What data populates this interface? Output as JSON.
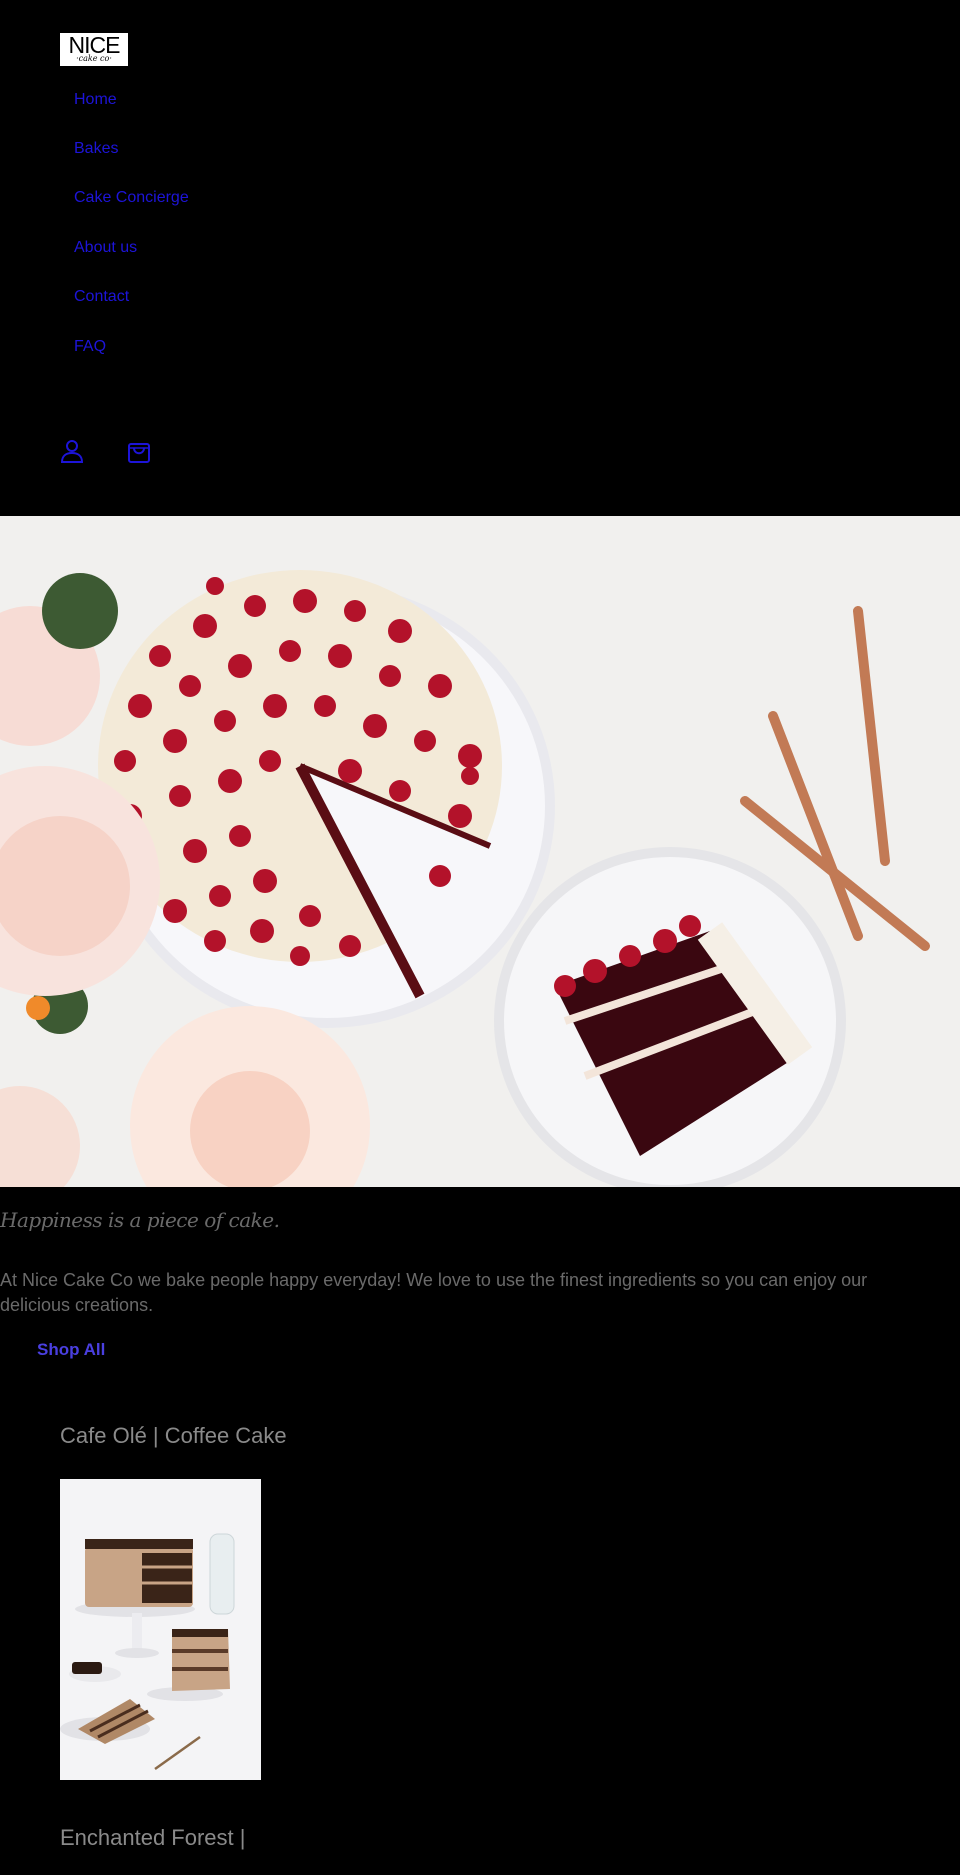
{
  "header": {
    "logo": {
      "line1": "NICE",
      "line2": "·cake co·"
    },
    "nav": [
      "Home",
      "Bakes",
      "Cake Concierge",
      "About us",
      "Contact",
      "FAQ"
    ],
    "icons": {
      "account": "account-icon",
      "cart": "cart-icon"
    }
  },
  "hero": {
    "image": "red-velvet-cake-hero"
  },
  "main": {
    "tagline": "Happiness is a piece of cake.",
    "intro": "At Nice Cake Co we bake people happy everyday! We love to use the finest ingredients so you can enjoy our delicious creations.",
    "shop_all": "Shop All"
  },
  "products": [
    {
      "title": "Cafe Olé | Coffee Cake"
    },
    {
      "title": "Enchanted Forest |"
    }
  ],
  "colors": {
    "background": "#000000",
    "link": "#1d14d9",
    "text": "#6a6a6a",
    "accent": "#4a3fe0"
  }
}
